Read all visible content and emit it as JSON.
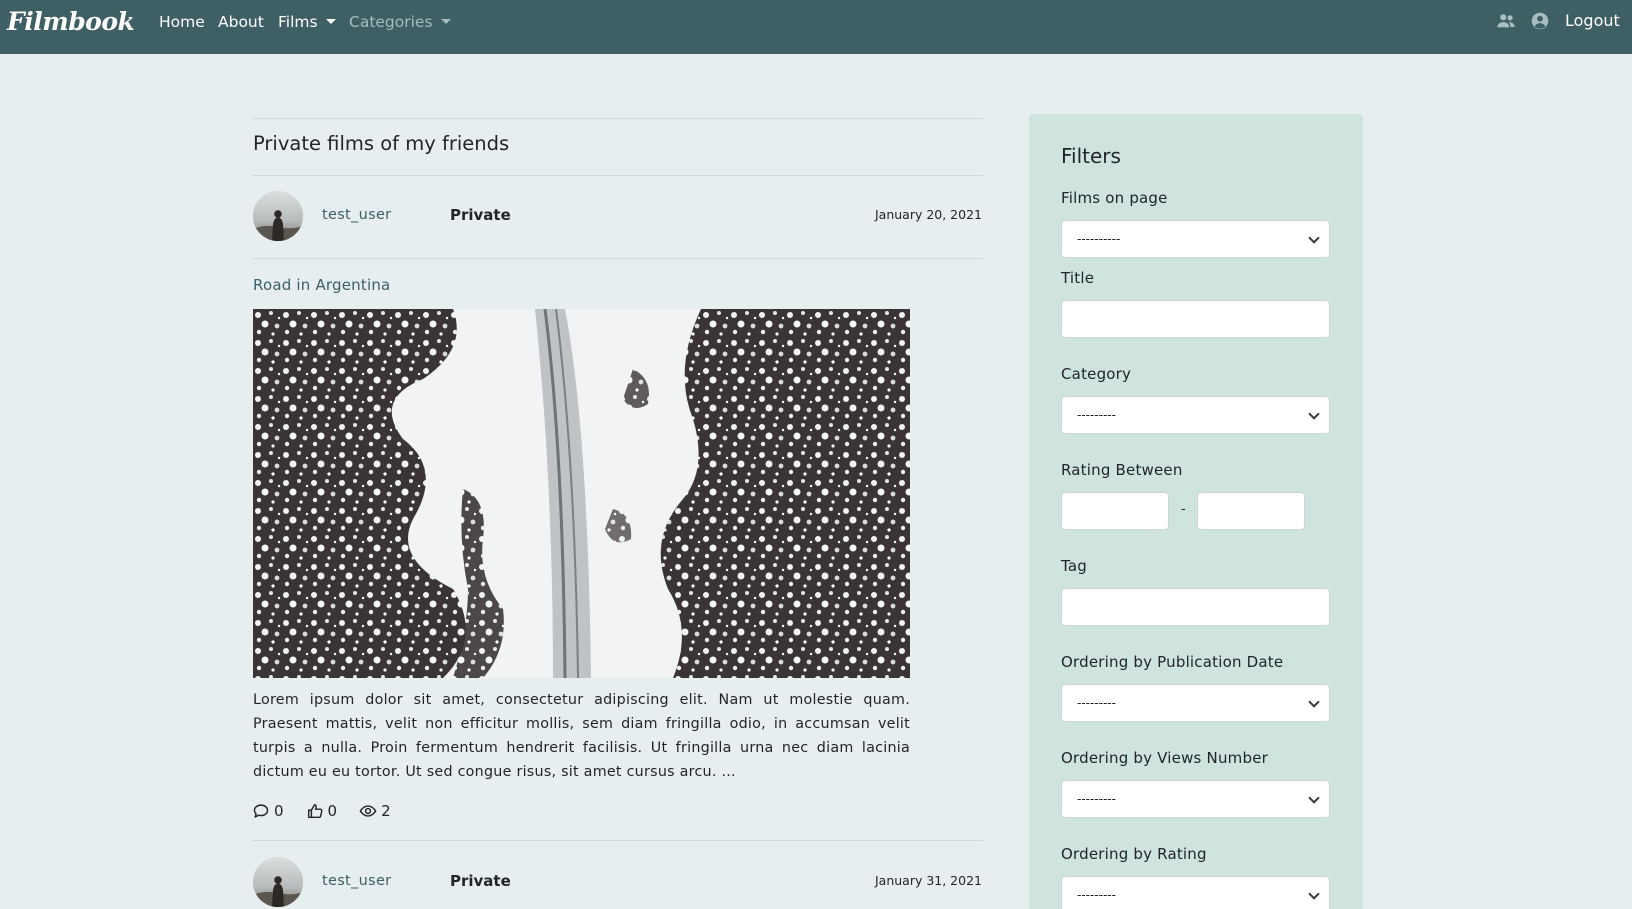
{
  "navbar": {
    "brand": "Filmbook",
    "links": [
      "Home",
      "About",
      "Films",
      "Categories"
    ],
    "logout_label": "Logout"
  },
  "main": {
    "page_title": "Private films of my friends",
    "posts": [
      {
        "username": "test_user",
        "privacy": "Private",
        "date": "January 20, 2021",
        "film_title": "Road in Argentina",
        "description": "Lorem ipsum dolor sit amet, consectetur adipiscing elit. Nam ut molestie quam. Praesent mattis, velit non efficitur mollis, sem diam fringilla odio, in accumsan velit turpis a nulla. Proin fermentum hendrerit facilisis. Ut fringilla urna nec diam lacinia dictum eu eu tortor. Ut sed congue risus, sit amet cursus arcu. ...",
        "comments": "0",
        "likes": "0",
        "views": "2"
      },
      {
        "username": "test_user",
        "privacy": "Private",
        "date": "January 31, 2021"
      }
    ]
  },
  "sidebar": {
    "title": "Filters",
    "films_on_page_label": "Films on page",
    "films_on_page_value": "----------",
    "title_label": "Title",
    "category_label": "Category",
    "category_value": "---------",
    "rating_label": "Rating Between",
    "rating_separator": "-",
    "tag_label": "Tag",
    "pubdate_label": "Ordering by Publication Date",
    "pubdate_value": "---------",
    "views_label": "Ordering by Views Number",
    "views_value": "---------",
    "rating_order_label": "Ordering by Rating",
    "rating_order_value": "---------"
  },
  "colors": {
    "navbar": "#3e5f63",
    "page_background": "#e7eeef",
    "sidebar_background": "#cfe3df",
    "accent_text": "#3e5f63"
  },
  "icons": [
    "users-icon",
    "user-circle-icon",
    "comment-icon",
    "thumbs-up-icon",
    "eye-icon",
    "chevron-down-icon"
  ]
}
